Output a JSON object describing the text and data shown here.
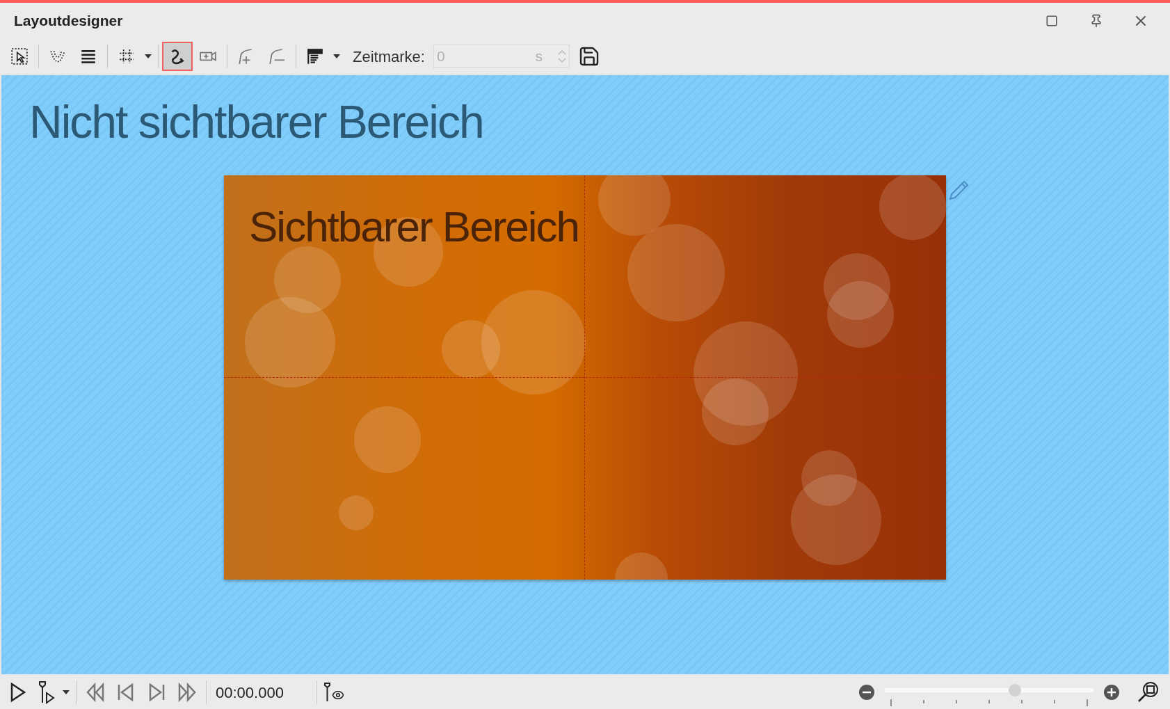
{
  "window": {
    "title": "Layoutdesigner"
  },
  "toolbar": {
    "groups": [
      [
        {
          "kind": "select",
          "selected": false
        }
      ],
      [
        {
          "kind": "points",
          "selected": false
        },
        {
          "kind": "layers",
          "selected": false
        }
      ],
      [
        {
          "kind": "grid",
          "selected": false,
          "menu": true
        }
      ],
      [
        {
          "kind": "path",
          "selected": true
        },
        {
          "kind": "camera",
          "selected": false
        }
      ],
      [
        {
          "kind": "add-point",
          "selected": false
        },
        {
          "kind": "remove-point",
          "selected": false
        }
      ],
      [
        {
          "kind": "text-layout",
          "selected": false,
          "menu": true
        }
      ]
    ],
    "timestamp": {
      "label": "Zeitmarke:",
      "value": "0",
      "unit": "s",
      "disabled": true
    }
  },
  "canvas": {
    "outside_label": "Nicht sichtbarer Bereich",
    "slide": {
      "label": "Sichtbarer Bereich"
    }
  },
  "playback": {
    "time": "00:00.000"
  },
  "zoom": {
    "level": 0.63
  }
}
